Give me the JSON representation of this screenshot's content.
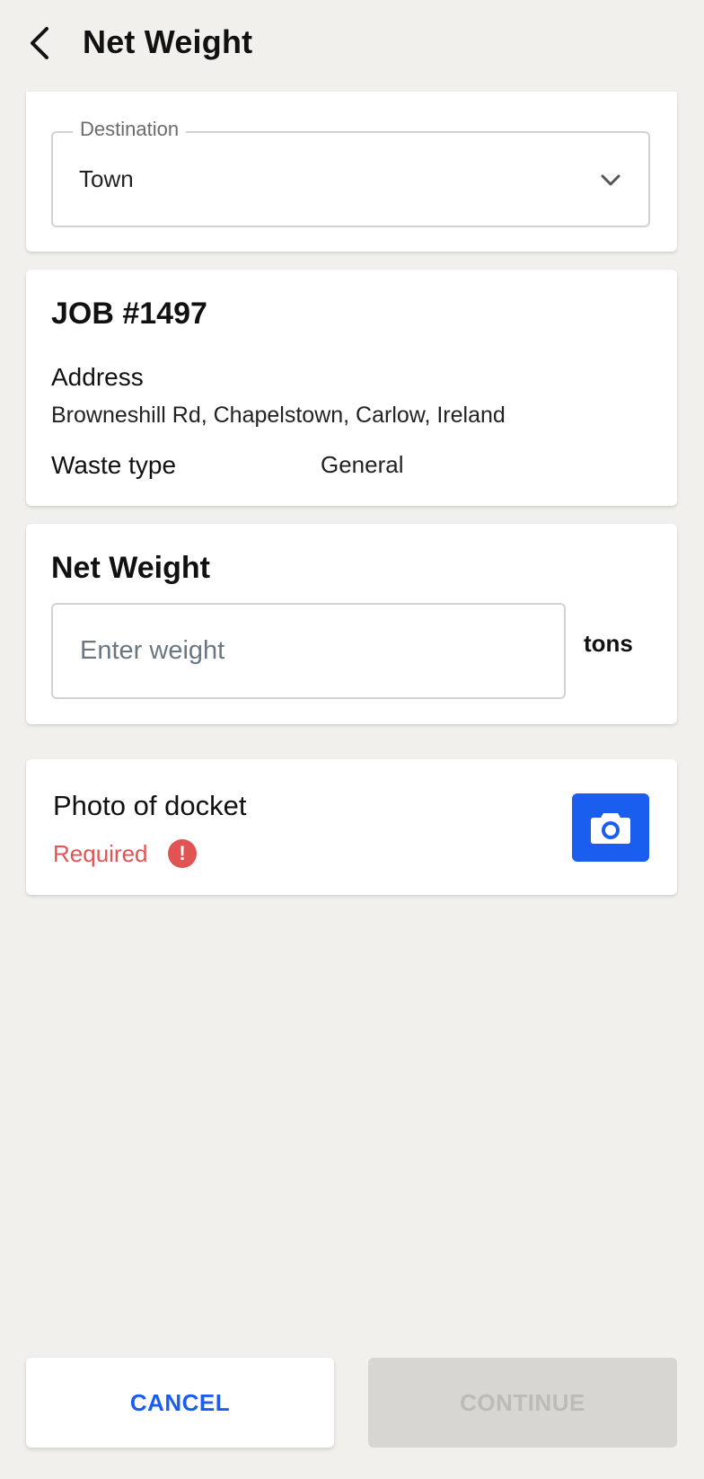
{
  "header": {
    "title": "Net Weight",
    "back_icon": "chevron-left-icon"
  },
  "destination": {
    "label": "Destination",
    "value": "Town",
    "icon": "chevron-down-icon"
  },
  "job": {
    "title": "JOB #1497",
    "address_label": "Address",
    "address_value": "Browneshill Rd, Chapelstown, Carlow, Ireland",
    "waste_type_label": "Waste type",
    "waste_type_value": "General"
  },
  "net_weight": {
    "title": "Net Weight",
    "placeholder": "Enter weight",
    "value": "",
    "unit": "tons"
  },
  "photo": {
    "title": "Photo of docket",
    "required_label": "Required",
    "required_icon_glyph": "!",
    "camera_icon": "camera-icon"
  },
  "footer": {
    "cancel_label": "CANCEL",
    "continue_label": "CONTINUE"
  },
  "colors": {
    "background": "#f1f0ec",
    "accent": "#1a5ef0",
    "error": "#e25454",
    "disabled_bg": "#d7d6d2",
    "disabled_text": "#bcbbb8"
  }
}
